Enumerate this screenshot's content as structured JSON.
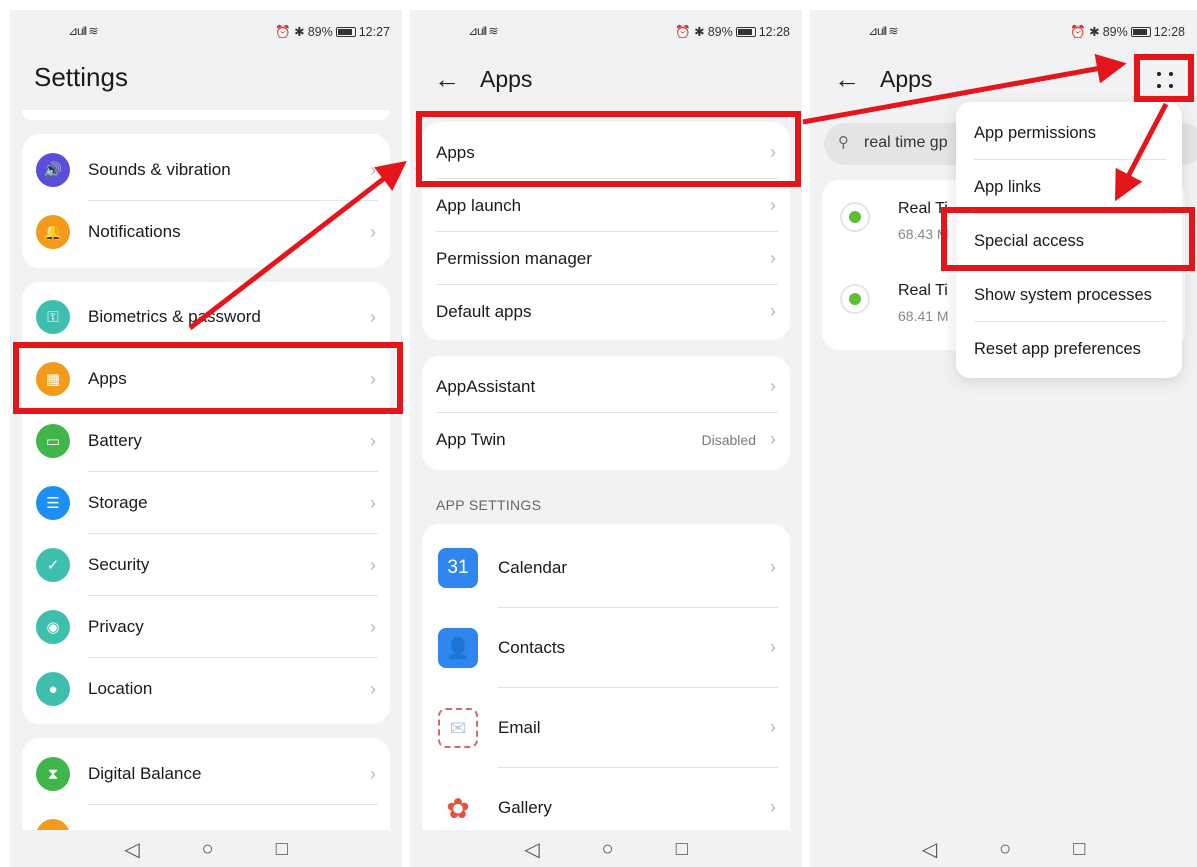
{
  "colors": {
    "highlight": "#e5161b",
    "panel_bg": "#f1f2f4",
    "card_bg": "#ffffff"
  },
  "status": [
    {
      "signal": "⊿ull ≋",
      "right_icons": "⏰ ✱",
      "battery": "89%",
      "time": "12:27"
    },
    {
      "signal": "⊿ull ≋",
      "right_icons": "⏰ ✱",
      "battery": "89%",
      "time": "12:28"
    },
    {
      "signal": "⊿ull ≋",
      "right_icons": "⏰ ✱",
      "battery": "89%",
      "time": "12:28"
    }
  ],
  "settings": {
    "title": "Settings",
    "group1": [
      {
        "label": "Sounds & vibration",
        "icon": "speaker-icon",
        "color": "#5b4fd9"
      },
      {
        "label": "Notifications",
        "icon": "bell-icon",
        "color": "#f39a1a"
      }
    ],
    "group2": [
      {
        "label": "Biometrics & password",
        "icon": "key-icon",
        "color": "#3ebfae"
      },
      {
        "label": "Apps",
        "icon": "apps-grid-icon",
        "color": "#f39a1a"
      },
      {
        "label": "Battery",
        "icon": "battery-icon",
        "color": "#3fb54a"
      },
      {
        "label": "Storage",
        "icon": "storage-icon",
        "color": "#1e8ff2"
      },
      {
        "label": "Security",
        "icon": "shield-icon",
        "color": "#3ebfae"
      },
      {
        "label": "Privacy",
        "icon": "privacy-icon",
        "color": "#3ebfae"
      },
      {
        "label": "Location",
        "icon": "location-pin-icon",
        "color": "#3ebfae"
      }
    ],
    "group3": [
      {
        "label": "Digital Balance",
        "icon": "hourglass-icon",
        "color": "#3fb54a"
      }
    ]
  },
  "apps_page": {
    "title": "Apps",
    "group1": [
      {
        "label": "Apps"
      },
      {
        "label": "App launch"
      },
      {
        "label": "Permission manager"
      },
      {
        "label": "Default apps"
      }
    ],
    "group2": [
      {
        "label": "AppAssistant",
        "value": ""
      },
      {
        "label": "App Twin",
        "value": "Disabled"
      }
    ],
    "section_header": "APP SETTINGS",
    "app_list": [
      {
        "label": "Calendar",
        "icon": "calendar-icon",
        "glyph": "31",
        "color": "#2f86ef"
      },
      {
        "label": "Contacts",
        "icon": "contacts-icon",
        "glyph": "👤",
        "color": "#2f86ef"
      },
      {
        "label": "Email",
        "icon": "email-icon",
        "glyph": "✉",
        "color": "#ffffff"
      },
      {
        "label": "Gallery",
        "icon": "gallery-icon",
        "glyph": "✿",
        "color": "#ffffff"
      }
    ]
  },
  "apps_menu_page": {
    "title": "Apps",
    "search_value": "real time gp",
    "apps": [
      {
        "name": "Real Ti",
        "size": "68.43 M"
      },
      {
        "name": "Real Ti",
        "size": "68.41 M"
      }
    ],
    "menu": [
      {
        "label": "App permissions"
      },
      {
        "label": "App links"
      },
      {
        "label": "Special access"
      },
      {
        "label": "Show system processes"
      },
      {
        "label": "Reset app preferences"
      }
    ]
  },
  "nav": {
    "back": "◁",
    "home": "○",
    "recent": "□"
  }
}
